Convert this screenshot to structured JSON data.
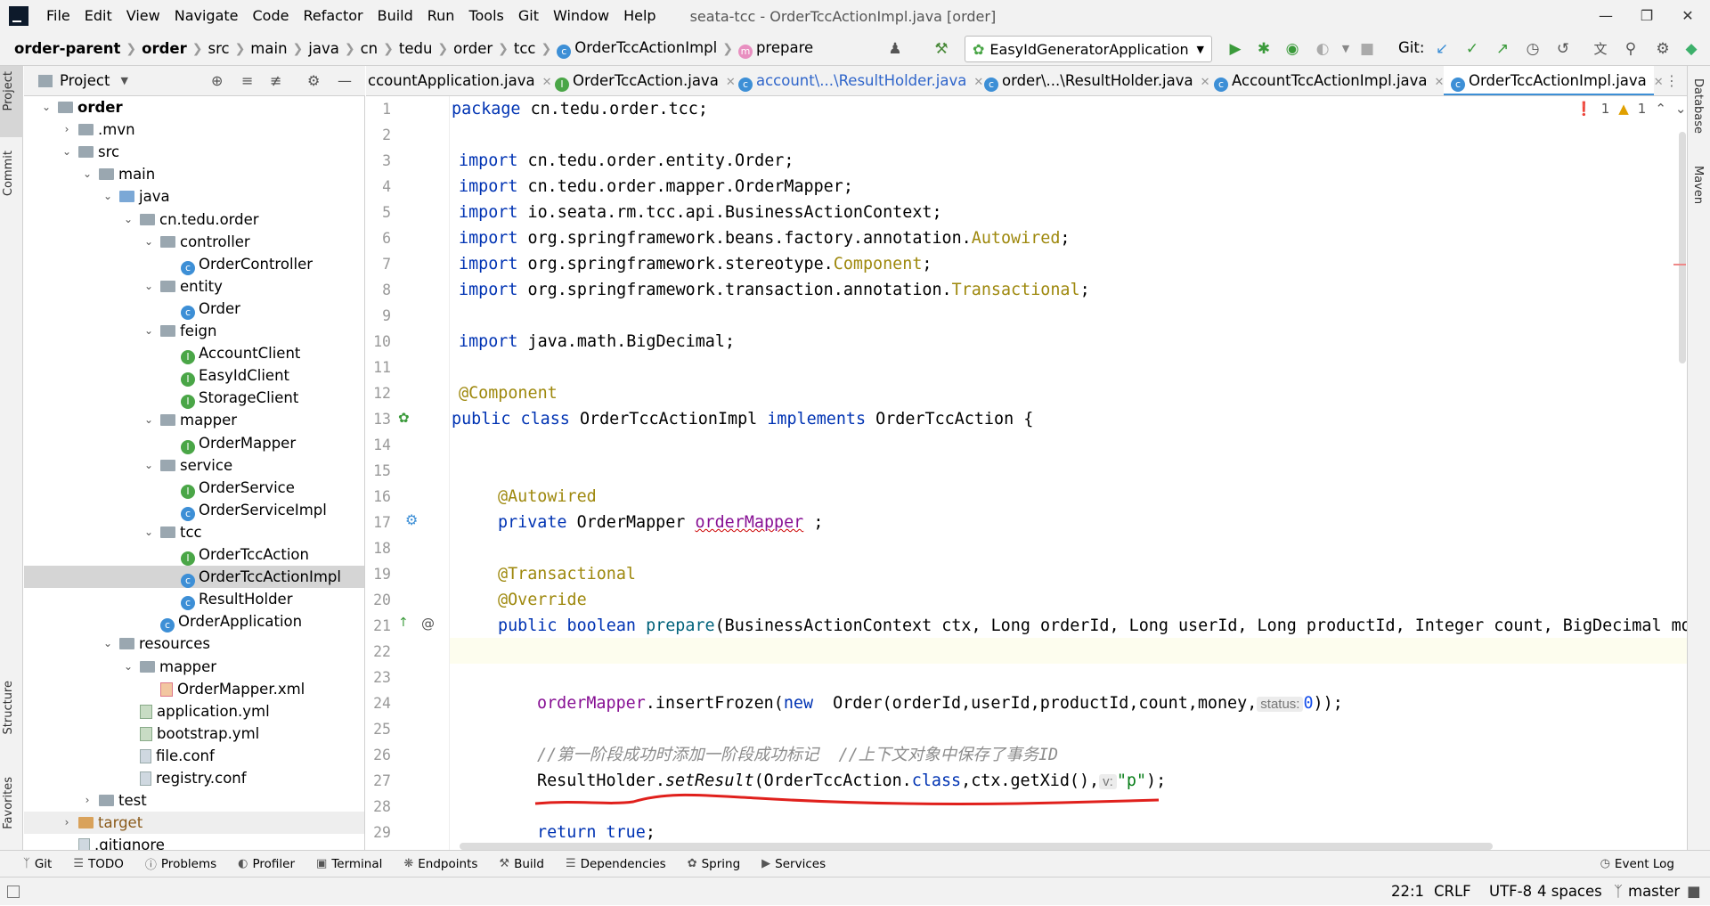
{
  "menubar": {
    "items": [
      "File",
      "Edit",
      "View",
      "Navigate",
      "Code",
      "Refactor",
      "Build",
      "Run",
      "Tools",
      "Git",
      "Window",
      "Help"
    ],
    "window_title": "seata-tcc - OrderTccActionImpl.java [order]"
  },
  "breadcrumb": [
    "order-parent",
    "order",
    "src",
    "main",
    "java",
    "cn",
    "tedu",
    "order",
    "tcc",
    "OrderTccActionImpl",
    "prepare"
  ],
  "toolbar": {
    "run_config": "EasyIdGeneratorApplication",
    "git_label": "Git:"
  },
  "project_panel": {
    "title": "Project",
    "tree": [
      {
        "label": "order",
        "type": "module",
        "indent": 0,
        "expanded": true,
        "bold": true
      },
      {
        "label": ".mvn",
        "type": "folder",
        "indent": 1,
        "expanded": false
      },
      {
        "label": "src",
        "type": "folder",
        "indent": 1,
        "expanded": true
      },
      {
        "label": "main",
        "type": "folder",
        "indent": 2,
        "expanded": true
      },
      {
        "label": "java",
        "type": "folder-blue",
        "indent": 3,
        "expanded": true
      },
      {
        "label": "cn.tedu.order",
        "type": "folder",
        "indent": 4,
        "expanded": true
      },
      {
        "label": "controller",
        "type": "folder",
        "indent": 5,
        "expanded": true
      },
      {
        "label": "OrderController",
        "type": "class",
        "indent": 6
      },
      {
        "label": "entity",
        "type": "folder",
        "indent": 5,
        "expanded": true
      },
      {
        "label": "Order",
        "type": "class",
        "indent": 6
      },
      {
        "label": "feign",
        "type": "folder",
        "indent": 5,
        "expanded": true
      },
      {
        "label": "AccountClient",
        "type": "interface",
        "indent": 6
      },
      {
        "label": "EasyIdClient",
        "type": "interface",
        "indent": 6
      },
      {
        "label": "StorageClient",
        "type": "interface",
        "indent": 6
      },
      {
        "label": "mapper",
        "type": "folder",
        "indent": 5,
        "expanded": true
      },
      {
        "label": "OrderMapper",
        "type": "interface",
        "indent": 6
      },
      {
        "label": "service",
        "type": "folder",
        "indent": 5,
        "expanded": true
      },
      {
        "label": "OrderService",
        "type": "interface",
        "indent": 6
      },
      {
        "label": "OrderServiceImpl",
        "type": "class",
        "indent": 6
      },
      {
        "label": "tcc",
        "type": "folder",
        "indent": 5,
        "expanded": true
      },
      {
        "label": "OrderTccAction",
        "type": "interface",
        "indent": 6
      },
      {
        "label": "OrderTccActionImpl",
        "type": "class",
        "indent": 6,
        "selected": true
      },
      {
        "label": "ResultHolder",
        "type": "class",
        "indent": 6
      },
      {
        "label": "OrderApplication",
        "type": "class-app",
        "indent": 5
      },
      {
        "label": "resources",
        "type": "folder",
        "indent": 3,
        "expanded": true
      },
      {
        "label": "mapper",
        "type": "folder",
        "indent": 4,
        "expanded": true
      },
      {
        "label": "OrderMapper.xml",
        "type": "xml",
        "indent": 5
      },
      {
        "label": "application.yml",
        "type": "yml",
        "indent": 4
      },
      {
        "label": "bootstrap.yml",
        "type": "yml",
        "indent": 4
      },
      {
        "label": "file.conf",
        "type": "file",
        "indent": 4
      },
      {
        "label": "registry.conf",
        "type": "file",
        "indent": 4
      },
      {
        "label": "test",
        "type": "folder",
        "indent": 2,
        "expanded": false
      },
      {
        "label": "target",
        "type": "folder-orange",
        "indent": 1,
        "expanded": false,
        "dim": true
      },
      {
        "label": ".gitignore",
        "type": "file",
        "indent": 1
      }
    ]
  },
  "editor_tabs": [
    {
      "label": "ccountApplication.java",
      "icon": "none"
    },
    {
      "label": "OrderTccAction.java",
      "icon": "interface"
    },
    {
      "label": "account\\...\\ResultHolder.java",
      "icon": "class"
    },
    {
      "label": "order\\...\\ResultHolder.java",
      "icon": "class"
    },
    {
      "label": "AccountTccActionImpl.java",
      "icon": "class"
    },
    {
      "label": "OrderTccActionImpl.java",
      "icon": "class",
      "active": true
    }
  ],
  "inspections": {
    "errors": "1",
    "warnings": "1"
  },
  "code": {
    "l1_pkg": "package",
    "l1_rest": " cn.tedu.order.tcc;",
    "imp": "import",
    "l3": " cn.tedu.order.entity.Order;",
    "l4": " cn.tedu.order.mapper.OrderMapper;",
    "l5": " io.seata.rm.tcc.api.BusinessActionContext;",
    "l6a": " org.springframework.beans.factory.annotation.",
    "l6b": "Autowired",
    "l7a": " org.springframework.stereotype.",
    "l7b": "Component",
    "l8a": " org.springframework.transaction.annotation.",
    "l8b": "Transactional",
    "l10": " java.math.BigDecimal;",
    "l12": "@Component",
    "l13a": "public class",
    "l13b": " OrderTccActionImpl ",
    "l13c": "implements",
    "l13d": " OrderTccAction {",
    "l16": "@Autowired",
    "l17a": "private",
    "l17b": " OrderMapper ",
    "l17c": "orderMapper",
    "l17d": " ;",
    "l19": "@Transactional",
    "l20": "@Override",
    "l21a": "public boolean",
    "l21b": " prepare",
    "l21c": "(BusinessActionContext ctx, Long orderId, Long userId, Long productId, Integer count, BigDecimal mor",
    "l23a": "orderMapper",
    "l23b": ".insertFrozen(",
    "l23c": "new",
    "l23d": "  Order(orderId,userId,productId,count,money,",
    "l23hint": "status:",
    "l23e": "0",
    "l23f": "));",
    "l25": "//第一阶段成功时添加一阶段成功标记  //上下文对象中保存了事务ID",
    "l26a": "ResultHolder.",
    "l26b": "setResult",
    "l26c": "(OrderTccAction.",
    "l26d": "class",
    "l26e": ",ctx.getXid(),",
    "l26hint": "v:",
    "l26f": "\"p\"",
    "l26g": ");",
    "l28a": "return",
    "l28b": "true",
    "l28c": ";",
    "l29": "}"
  },
  "line_numbers": [
    "1",
    "2",
    "3",
    "4",
    "5",
    "6",
    "7",
    "8",
    "9",
    "10",
    "11",
    "12",
    "13",
    "14",
    "15",
    "16",
    "17",
    "18",
    "19",
    "20",
    "21",
    "22",
    "23",
    "24",
    "25",
    "26",
    "27",
    "28",
    "29"
  ],
  "bottom_tools": [
    "Git",
    "TODO",
    "Problems",
    "Profiler",
    "Terminal",
    "Endpoints",
    "Build",
    "Dependencies",
    "Spring",
    "Services"
  ],
  "event_log": "Event Log",
  "left_tool_labels": [
    "Project",
    "Commit",
    "Structure",
    "Favorites"
  ],
  "right_tool_labels": [
    "Database",
    "Maven"
  ],
  "statusbar": {
    "position": "22:1",
    "line_sep": "CRLF",
    "encoding": "UTF-8",
    "indent": "4 spaces",
    "branch": "master"
  },
  "colors": {
    "accent": "#3d8fd6",
    "annotation": "#9e880d",
    "keyword": "#0033b3",
    "field": "#871094",
    "string": "#067d17",
    "red_underline": "#e0201c"
  }
}
